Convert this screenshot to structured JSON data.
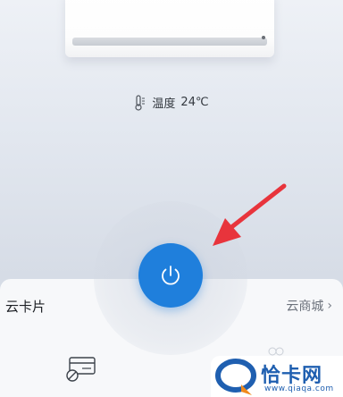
{
  "temperature": {
    "label": "温度",
    "value": "24℃",
    "icon": "thermometer-icon"
  },
  "device": {
    "power_icon": "power-icon",
    "accent_color": "#1f7fdc"
  },
  "card": {
    "title": "云卡片",
    "link_label": "云商城",
    "link_chevron": "›",
    "feature_icon": "card-edit-icon"
  },
  "annotation": {
    "arrow_color": "#e8343c"
  },
  "watermark": {
    "name": "恰卡网",
    "url": "www.qiaqa.com",
    "color": "#1f5fb0"
  }
}
